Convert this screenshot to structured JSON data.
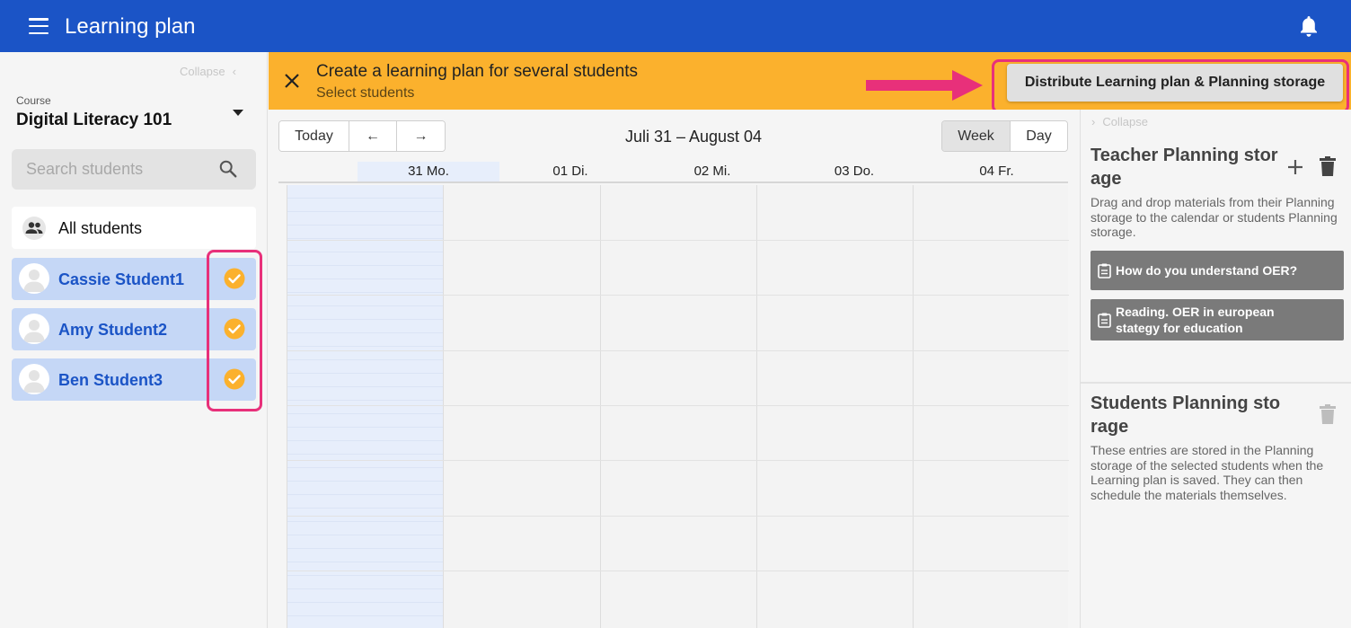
{
  "app": {
    "title": "Learning plan"
  },
  "sidebar": {
    "collapse_label": "Collapse",
    "course_caption": "Course",
    "course_name": "Digital Literacy 101",
    "search_placeholder": "Search students",
    "all_students_label": "All students",
    "students": [
      {
        "name": "Cassie Student1",
        "checked": true
      },
      {
        "name": "Amy Student2",
        "checked": true
      },
      {
        "name": "Ben Student3",
        "checked": true
      }
    ]
  },
  "banner": {
    "title": "Create a learning plan for several students",
    "subtitle": "Select students",
    "distribute_label": "Distribute Learning plan & Planning storage"
  },
  "calendar": {
    "today_label": "Today",
    "prev_label": "←",
    "next_label": "→",
    "range_label": "Juli 31 – August 04",
    "week_label": "Week",
    "day_label": "Day",
    "view_selected": "Week",
    "days": [
      "31 Mo.",
      "01 Di.",
      "02 Mi.",
      "03 Do.",
      "04 Fr."
    ]
  },
  "panel": {
    "collapse_label": "Collapse",
    "teacher_title": "Teacher Planning storage",
    "teacher_desc": "Drag and drop materials from their Planning storage to the calendar or students Planning storage.",
    "materials": [
      "How do you understand OER?",
      "Reading. OER in european stategy for education"
    ],
    "students_title": "Students Planning storage",
    "students_desc": "These entries are stored in the Planning storage of the selected students when the Learning plan is saved. They can then schedule the materials themselves."
  },
  "colors": {
    "appbar": "#1b54c6",
    "banner": "#fbb12d",
    "student_bg": "#c5d7f6",
    "check": "#fbb12d",
    "highlight": "#e8307a"
  }
}
